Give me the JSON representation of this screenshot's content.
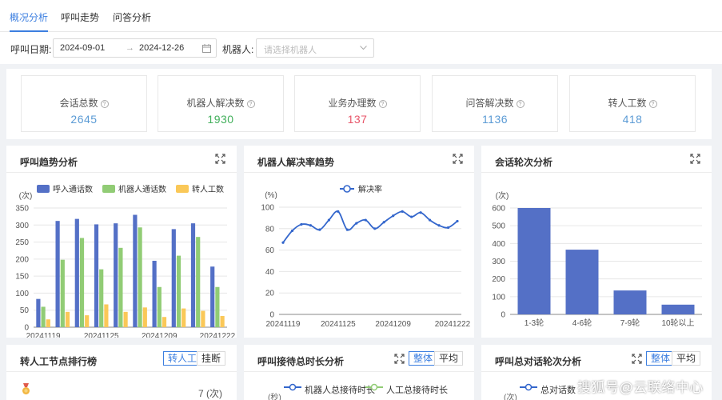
{
  "tabs": [
    {
      "label": "概况分析",
      "active": true
    },
    {
      "label": "呼叫走势",
      "active": false
    },
    {
      "label": "问答分析",
      "active": false
    }
  ],
  "filters": {
    "date_label": "呼叫日期:",
    "date_start": "2024-09-01",
    "date_end": "2024-12-26",
    "robot_label": "机器人:",
    "robot_placeholder": "请选择机器人"
  },
  "kpis": [
    {
      "label": "会话总数",
      "value": "2645",
      "color": "#5b9bd5"
    },
    {
      "label": "机器人解决数",
      "value": "1930",
      "color": "#43b05c"
    },
    {
      "label": "业务办理数",
      "value": "137",
      "color": "#e8566a"
    },
    {
      "label": "问答解决数",
      "value": "1136",
      "color": "#5b9bd5"
    },
    {
      "label": "转人工数",
      "value": "418",
      "color": "#5b9bd5"
    }
  ],
  "cards": {
    "call_trend": {
      "title": "呼叫趋势分析"
    },
    "robot_rate": {
      "title": "机器人解决率趋势"
    },
    "rounds": {
      "title": "会话轮次分析"
    },
    "transfer_rank": {
      "title": "转人工节点排行榜",
      "seg_on": "转人工",
      "seg_off": "挂断",
      "row1_value": "7 (次)"
    },
    "duration": {
      "title": "呼叫接待总时长分析",
      "seg_on": "整体",
      "seg_off": "平均",
      "unit": "(秒)",
      "legend": [
        "机器人总接待时长",
        "人工总接待时长"
      ]
    },
    "dialog_rounds": {
      "title": "呼叫总对话轮次分析",
      "seg_on": "整体",
      "seg_off": "平均",
      "unit": "(次)",
      "legend": [
        "总对话数"
      ]
    }
  },
  "watermark": "搜狐号@云联络中心",
  "chart_data": [
    {
      "type": "bar",
      "unit": "(次)",
      "ylim": [
        0,
        350
      ],
      "yticks": [
        0,
        50,
        100,
        150,
        200,
        250,
        300,
        350
      ],
      "legend_position": "top",
      "x_tick_labels": [
        "20241119",
        "20241125",
        "20241209",
        "20241222"
      ],
      "series": [
        {
          "name": "呼入通话数",
          "color": "#5470c6",
          "values": [
            83,
            312,
            318,
            302,
            305,
            330,
            195,
            288,
            305,
            178
          ]
        },
        {
          "name": "机器人通话数",
          "color": "#91cc75",
          "values": [
            60,
            198,
            262,
            170,
            233,
            293,
            118,
            210,
            265,
            118
          ]
        },
        {
          "name": "转人工数",
          "color": "#fac858",
          "values": [
            23,
            45,
            35,
            67,
            45,
            58,
            30,
            55,
            48,
            33
          ]
        }
      ]
    },
    {
      "type": "line",
      "unit": "(%)",
      "ylim": [
        0,
        100
      ],
      "yticks": [
        0,
        20,
        40,
        60,
        80,
        100
      ],
      "legend_position": "top",
      "x_tick_labels": [
        "20241119",
        "20241125",
        "20241209",
        "20241222"
      ],
      "series": [
        {
          "name": "解决率",
          "color": "#3366cc",
          "values": [
            67,
            78,
            84,
            83,
            79,
            88,
            96,
            79,
            85,
            88,
            80,
            86,
            92,
            96,
            91,
            95,
            88,
            83,
            81,
            87
          ]
        }
      ]
    },
    {
      "type": "bar",
      "unit": "(次)",
      "ylim": [
        0,
        600
      ],
      "yticks": [
        0,
        100,
        200,
        300,
        400,
        500,
        600
      ],
      "categories": [
        "1-3轮",
        "4-6轮",
        "7-9轮",
        "10轮以上"
      ],
      "series": [
        {
          "name": "",
          "color": "#5470c6",
          "values": [
            600,
            365,
            135,
            55
          ]
        }
      ]
    }
  ]
}
